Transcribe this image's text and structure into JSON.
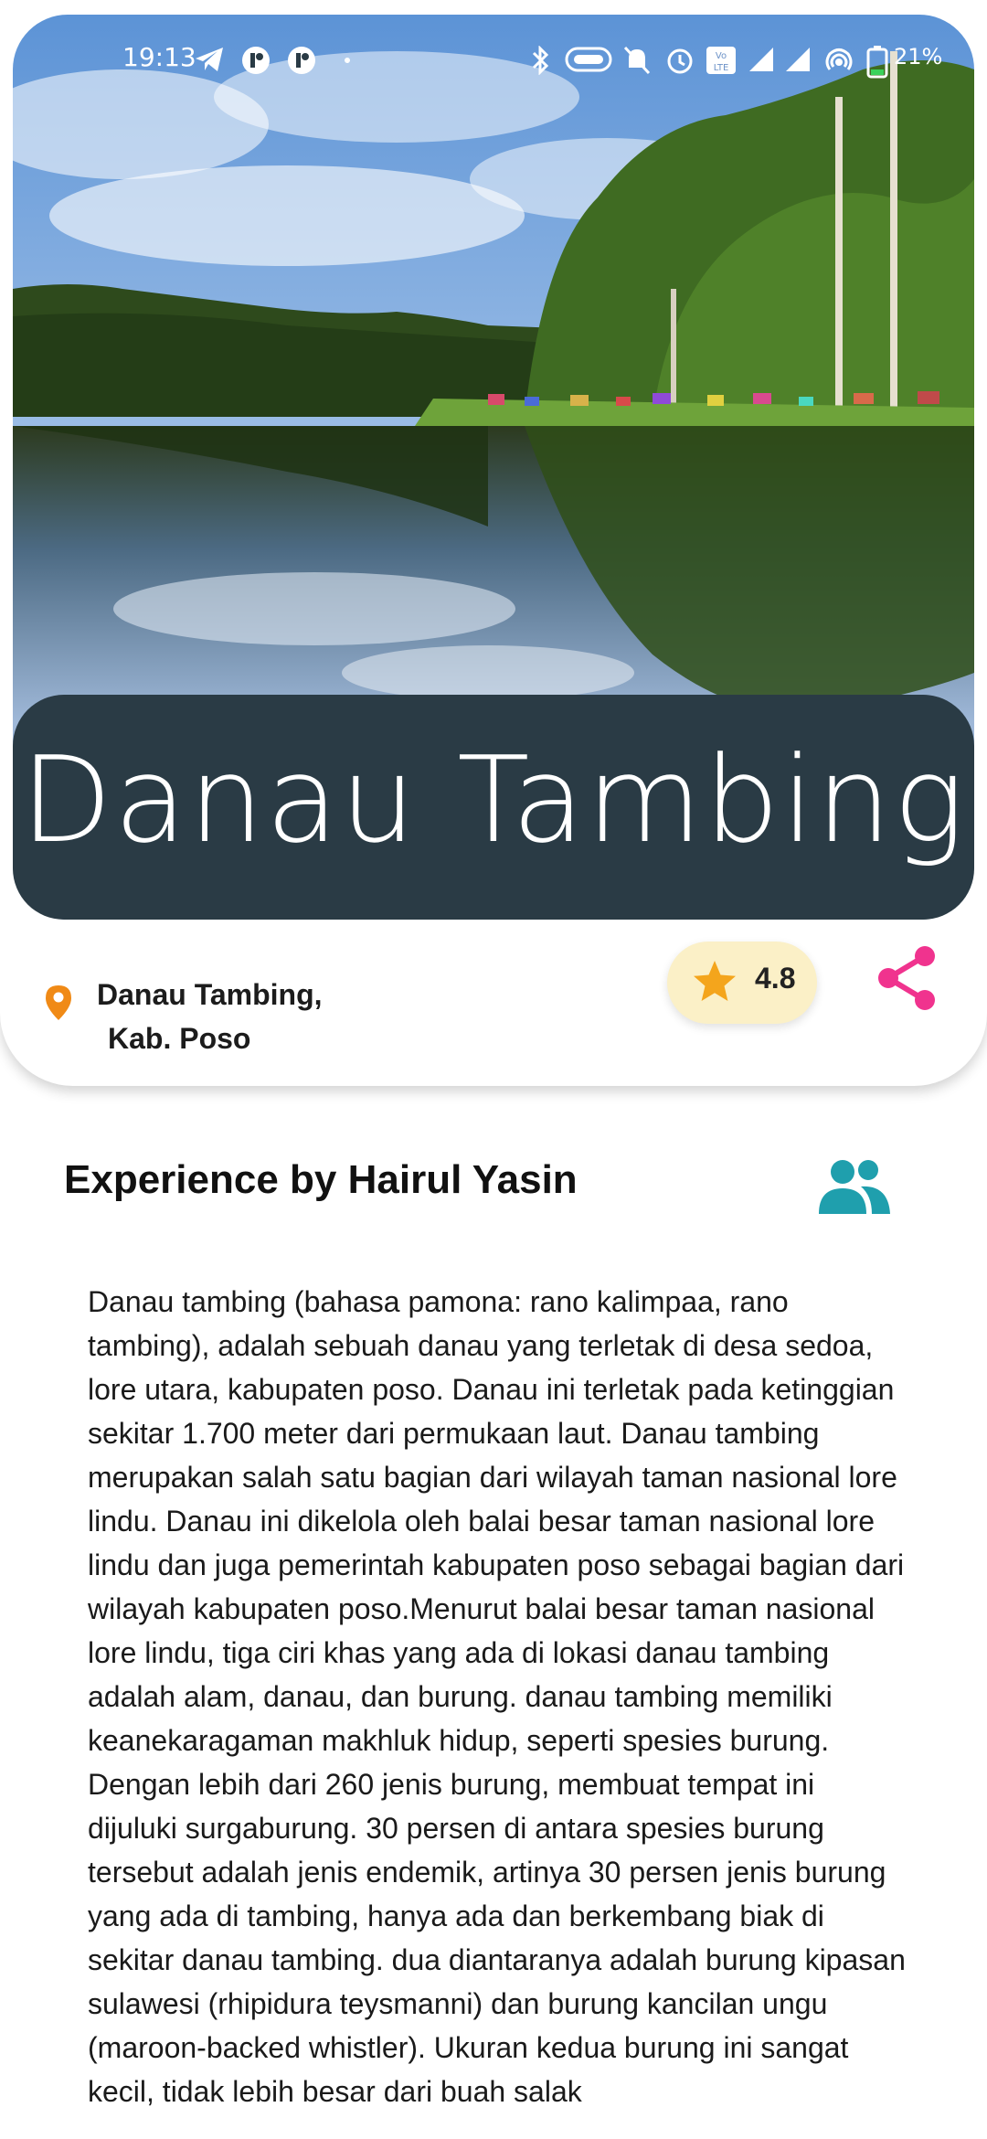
{
  "status_bar": {
    "time": "19:13",
    "battery_percent": "21%",
    "icons": [
      "telegram-icon",
      "app-icon",
      "app-icon",
      "dot-icon",
      "bluetooth-icon",
      "nfc-icon",
      "mute-icon",
      "alarm-icon",
      "volte-icon",
      "signal-icon",
      "signal-icon",
      "hotspot-icon",
      "battery-icon"
    ]
  },
  "place": {
    "title": "Danau Tambing",
    "location_line1": "Danau Tambing,",
    "location_line2": "Kab. Poso",
    "rating": "4.8"
  },
  "experience": {
    "heading": "Experience by Hairul Yasin",
    "body": "Danau tambing (bahasa pamona: rano kalimpaa, rano tambing), adalah sebuah danau yang terletak di desa sedoa, lore utara, kabupaten poso. Danau ini terletak pada ketinggian sekitar 1.700 meter dari permukaan laut. Danau tambing merupakan salah satu bagian dari wilayah taman nasional lore lindu. Danau ini dikelola oleh balai besar taman nasional lore lindu dan juga pemerintah kabupaten poso sebagai bagian dari wilayah kabupaten poso.Menurut balai besar taman nasional lore lindu, tiga ciri khas yang ada di lokasi danau tambing adalah alam, danau, dan burung. danau tambing memiliki keanekaragaman makhluk hidup, seperti spesies burung. Dengan lebih dari 260 jenis burung, membuat tempat ini dijuluki surgaburung. 30 persen di antara spesies burung tersebut adalah jenis endemik, artinya 30 persen jenis burung yang ada di tambing, hanya ada dan berkembang biak di sekitar danau tambing. dua diantaranya adalah burung kipasan sulawesi (rhipidura teysmanni) dan burung kancilan ungu (maroon-backed whistler). Ukuran kedua burung ini sangat kecil, tidak lebih besar dari buah salak"
  },
  "colors": {
    "banner": "#2a3b45",
    "pin": "#f08a16",
    "star": "#f4a51c",
    "rating_bg": "#fbf0c7",
    "share": "#f0338e",
    "users": "#1f9fad"
  }
}
